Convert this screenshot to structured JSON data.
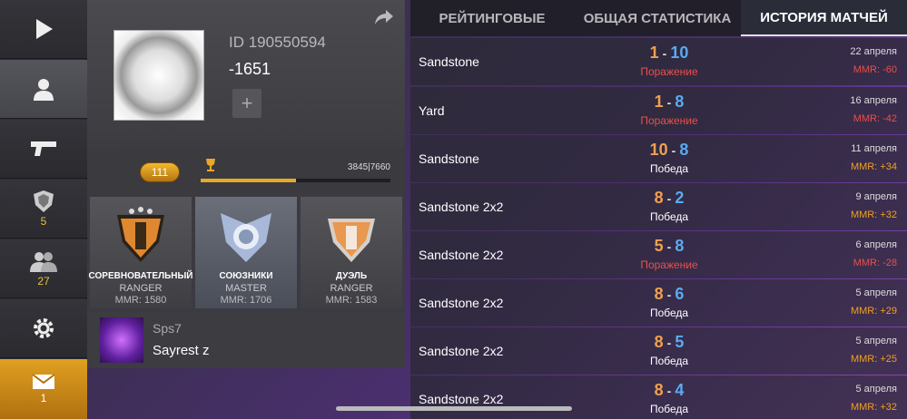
{
  "sidebar": {
    "items": [
      {
        "icon": "play-icon",
        "count": ""
      },
      {
        "icon": "profile-icon",
        "count": ""
      },
      {
        "icon": "pistol-icon",
        "count": ""
      },
      {
        "icon": "clan-shield-icon",
        "count": "5"
      },
      {
        "icon": "friends-icon",
        "count": "27"
      },
      {
        "icon": "gear-icon",
        "count": ""
      },
      {
        "icon": "mail-icon",
        "count": "1"
      }
    ]
  },
  "profile": {
    "id": "ID 190550594",
    "score": "-1651",
    "plus": "+",
    "level": "111",
    "xp_text": "3845|7660",
    "xp_fraction": 0.502
  },
  "ranks": [
    {
      "name": "СОРЕВНОВАТЕЛЬНЫЙ",
      "tier": "RANGER",
      "mmr": "MMR: 1580"
    },
    {
      "name": "СОЮЗНИКИ",
      "tier": "MASTER",
      "mmr": "MMR: 1706"
    },
    {
      "name": "ДУЭЛЬ",
      "tier": "RANGER",
      "mmr": "MMR: 1583"
    }
  ],
  "friend": {
    "tag": "Sps7",
    "name": "Sayrest z"
  },
  "tabs": [
    "РЕЙТИНГОВЫЕ",
    "ОБЩАЯ СТАТИСТИКА",
    "ИСТОРИЯ МАТЧЕЙ"
  ],
  "colors": {
    "win": "#ffffff",
    "loss": "#e8504a",
    "mmr_loss": "#e8504a",
    "mmr_win": "#f0a020",
    "score_a": "#f0a050",
    "score_b": "#5aaaf0"
  },
  "matches": [
    {
      "map": "Sandstone",
      "a": "1",
      "b": "10",
      "result": "Поражение",
      "date": "22 апреля",
      "mmr": "MMR: -60",
      "win": false
    },
    {
      "map": "Yard",
      "a": "1",
      "b": "8",
      "result": "Поражение",
      "date": "16 апреля",
      "mmr": "MMR: -42",
      "win": false
    },
    {
      "map": "Sandstone",
      "a": "10",
      "b": "8",
      "result": "Победа",
      "date": "11 апреля",
      "mmr": "MMR: +34",
      "win": true
    },
    {
      "map": "Sandstone 2x2",
      "a": "8",
      "b": "2",
      "result": "Победа",
      "date": "9 апреля",
      "mmr": "MMR: +32",
      "win": true
    },
    {
      "map": "Sandstone 2x2",
      "a": "5",
      "b": "8",
      "result": "Поражение",
      "date": "6 апреля",
      "mmr": "MMR: -28",
      "win": false
    },
    {
      "map": "Sandstone 2x2",
      "a": "8",
      "b": "6",
      "result": "Победа",
      "date": "5 апреля",
      "mmr": "MMR: +29",
      "win": true
    },
    {
      "map": "Sandstone 2x2",
      "a": "8",
      "b": "5",
      "result": "Победа",
      "date": "5 апреля",
      "mmr": "MMR: +25",
      "win": true
    },
    {
      "map": "Sandstone 2x2",
      "a": "8",
      "b": "4",
      "result": "Победа",
      "date": "5 апреля",
      "mmr": "MMR: +32",
      "win": true
    }
  ]
}
